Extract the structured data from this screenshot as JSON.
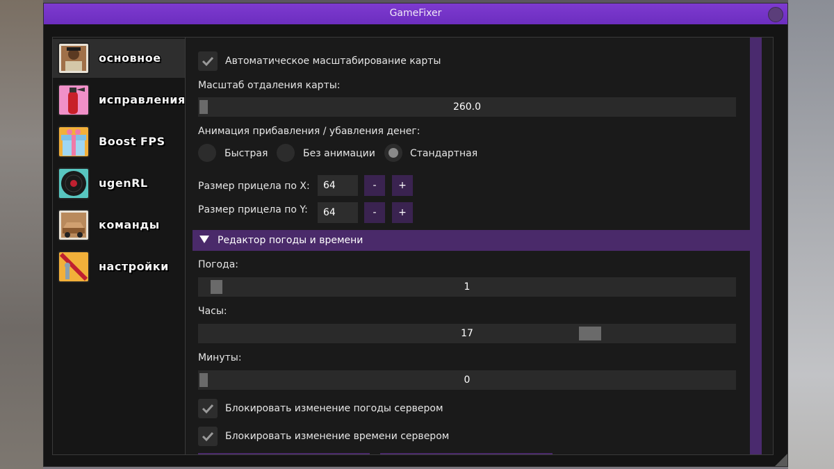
{
  "window": {
    "title": "GameFixer"
  },
  "sidebar": {
    "items": [
      {
        "label": "основное",
        "icon": "cj-portrait-icon",
        "active": true
      },
      {
        "label": "исправления",
        "icon": "fire-extinguisher-icon",
        "active": false
      },
      {
        "label": "Boost FPS",
        "icon": "gift-box-icon",
        "active": false
      },
      {
        "label": "ugenRL",
        "icon": "vinyl-record-icon",
        "active": false
      },
      {
        "label": "команды",
        "icon": "car-icon",
        "active": false
      },
      {
        "label": "настройки",
        "icon": "crossed-tool-icon",
        "active": false
      }
    ]
  },
  "main": {
    "auto_scale": {
      "label": "Автоматическое масштабирование карты",
      "checked": true
    },
    "map_zoom": {
      "label": "Масштаб отдаления карты:",
      "value": "260.0"
    },
    "money_anim": {
      "label": "Анимация прибавления / убавления денег:",
      "options": [
        "Быстрая",
        "Без анимации",
        "Стандартная"
      ],
      "selected": "Стандартная"
    },
    "crosshair_x": {
      "label": "Размер прицела по X:",
      "value": "64",
      "minus": "-",
      "plus": "+"
    },
    "crosshair_y": {
      "label": "Размер прицела по Y:",
      "value": "64",
      "minus": "-",
      "plus": "+"
    },
    "weather_section": {
      "label": "Редактор погоды и времени"
    },
    "weather": {
      "label": "Погода:",
      "value": "1"
    },
    "hours": {
      "label": "Часы:",
      "value": "17"
    },
    "minutes": {
      "label": "Минуты:",
      "value": "0"
    },
    "block_weather": {
      "label": "Блокировать изменение погоды сервером",
      "checked": true
    },
    "block_time": {
      "label": "Блокировать изменение времени сервером",
      "checked": true
    }
  },
  "colors": {
    "accent": "#6c2ebf",
    "section": "#4a2a6a",
    "panel": "#141414"
  }
}
